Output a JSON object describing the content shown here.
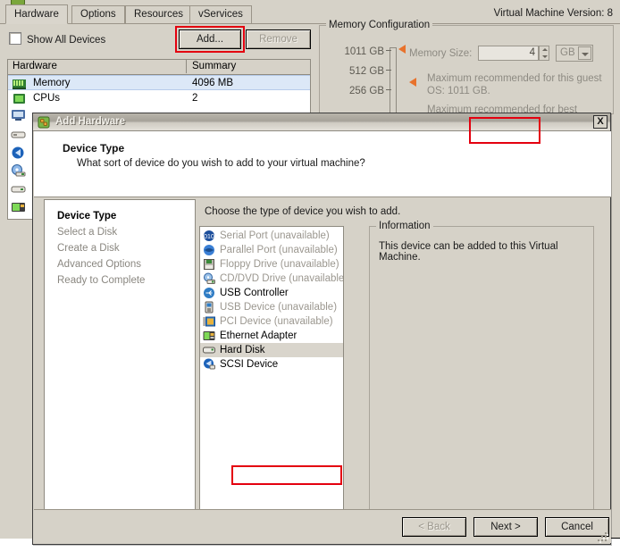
{
  "window": {
    "version_label": "Virtual Machine Version: 8",
    "tabs": [
      {
        "label": "Hardware",
        "active": true
      },
      {
        "label": "Options",
        "active": false
      },
      {
        "label": "Resources",
        "active": false
      },
      {
        "label": "vServices",
        "active": false
      }
    ],
    "show_all_devices_label": "Show All Devices",
    "add_button": "Add...",
    "remove_button": "Remove",
    "hardware_table": {
      "columns": [
        "Hardware",
        "Summary"
      ],
      "rows": [
        {
          "name": "Memory",
          "summary": "4096 MB",
          "icon": "memory-icon",
          "selected": true
        },
        {
          "name": "CPUs",
          "summary": "2",
          "icon": "cpu-icon",
          "selected": false
        }
      ]
    },
    "memory_configuration": {
      "legend": "Memory Configuration",
      "ticks": [
        "1011 GB",
        "512 GB",
        "256 GB"
      ],
      "memory_size_label": "Memory Size:",
      "memory_size_value": "4",
      "unit_value": "GB",
      "notes": [
        "Maximum recommended for this guest OS: 1011 GB.",
        "Maximum recommended for best"
      ]
    }
  },
  "dialog": {
    "title": "Add Hardware",
    "close_label": "X",
    "header_title": "Device Type",
    "header_subtitle": "What sort of device do you wish to add to your virtual machine?",
    "steps": [
      {
        "label": "Device Type",
        "active": true
      },
      {
        "label": "Select a Disk",
        "active": false
      },
      {
        "label": "Create a Disk",
        "active": false
      },
      {
        "label": "Advanced Options",
        "active": false
      },
      {
        "label": "Ready to Complete",
        "active": false
      }
    ],
    "body_prompt": "Choose the type of device you wish to add.",
    "devices": [
      {
        "label": "Serial Port (unavailable)",
        "icon": "serial-port-icon",
        "available": false,
        "selected": false
      },
      {
        "label": "Parallel Port (unavailable)",
        "icon": "parallel-port-icon",
        "available": false,
        "selected": false
      },
      {
        "label": "Floppy Drive (unavailable)",
        "icon": "floppy-drive-icon",
        "available": false,
        "selected": false
      },
      {
        "label": "CD/DVD Drive (unavailable)",
        "icon": "cd-dvd-drive-icon",
        "available": false,
        "selected": false
      },
      {
        "label": "USB Controller",
        "icon": "usb-controller-icon",
        "available": true,
        "selected": false
      },
      {
        "label": "USB Device (unavailable)",
        "icon": "usb-device-icon",
        "available": false,
        "selected": false
      },
      {
        "label": "PCI Device (unavailable)",
        "icon": "pci-device-icon",
        "available": false,
        "selected": false
      },
      {
        "label": "Ethernet Adapter",
        "icon": "ethernet-adapter-icon",
        "available": true,
        "selected": false
      },
      {
        "label": "Hard Disk",
        "icon": "hard-disk-icon",
        "available": true,
        "selected": true
      },
      {
        "label": "SCSI Device",
        "icon": "scsi-device-icon",
        "available": true,
        "selected": false
      }
    ],
    "information": {
      "legend": "Information",
      "text": "This device can be added to this Virtual Machine."
    },
    "footer": {
      "back": "< Back",
      "next": "Next >",
      "cancel": "Cancel"
    }
  },
  "highlights": {
    "color": "#e4000f",
    "targets": [
      "Add...",
      "Hard Disk",
      "Next >"
    ]
  }
}
